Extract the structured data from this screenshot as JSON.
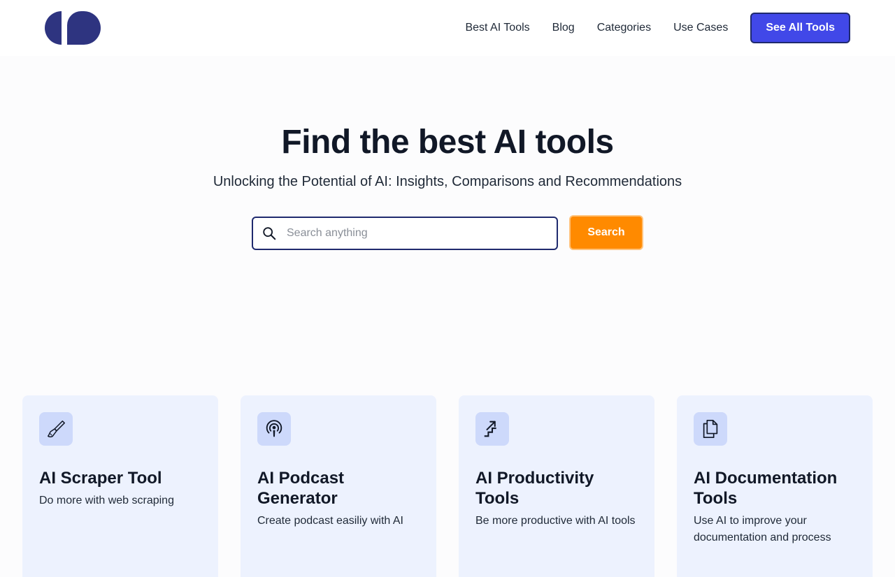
{
  "header": {
    "nav": [
      {
        "label": "Best AI Tools"
      },
      {
        "label": "Blog"
      },
      {
        "label": "Categories"
      },
      {
        "label": "Use Cases"
      }
    ],
    "cta_label": "See All Tools"
  },
  "hero": {
    "title": "Find the best AI tools",
    "subtitle": "Unlocking the Potential of AI: Insights, Comparisons and Recommendations"
  },
  "search": {
    "placeholder": "Search anything",
    "value": "",
    "button_label": "Search"
  },
  "cards": [
    {
      "icon": "brush-icon",
      "title": "AI Scraper Tool",
      "description": "Do more with web scraping"
    },
    {
      "icon": "podcast-icon",
      "title": "AI Podcast Generator",
      "description": "Create podcast easiliy with AI"
    },
    {
      "icon": "stairs-icon",
      "title": "AI Productivity Tools",
      "description": "Be more productive with AI tools"
    },
    {
      "icon": "documents-icon",
      "title": "AI Documentation Tools",
      "description": "Use AI to improve your documentation and process"
    }
  ],
  "colors": {
    "brand": "#2e3480",
    "cta": "#4148e8",
    "search_button": "#ff8a00",
    "card_bg": "#edf2fe",
    "icon_bg": "#cdd9fb"
  }
}
